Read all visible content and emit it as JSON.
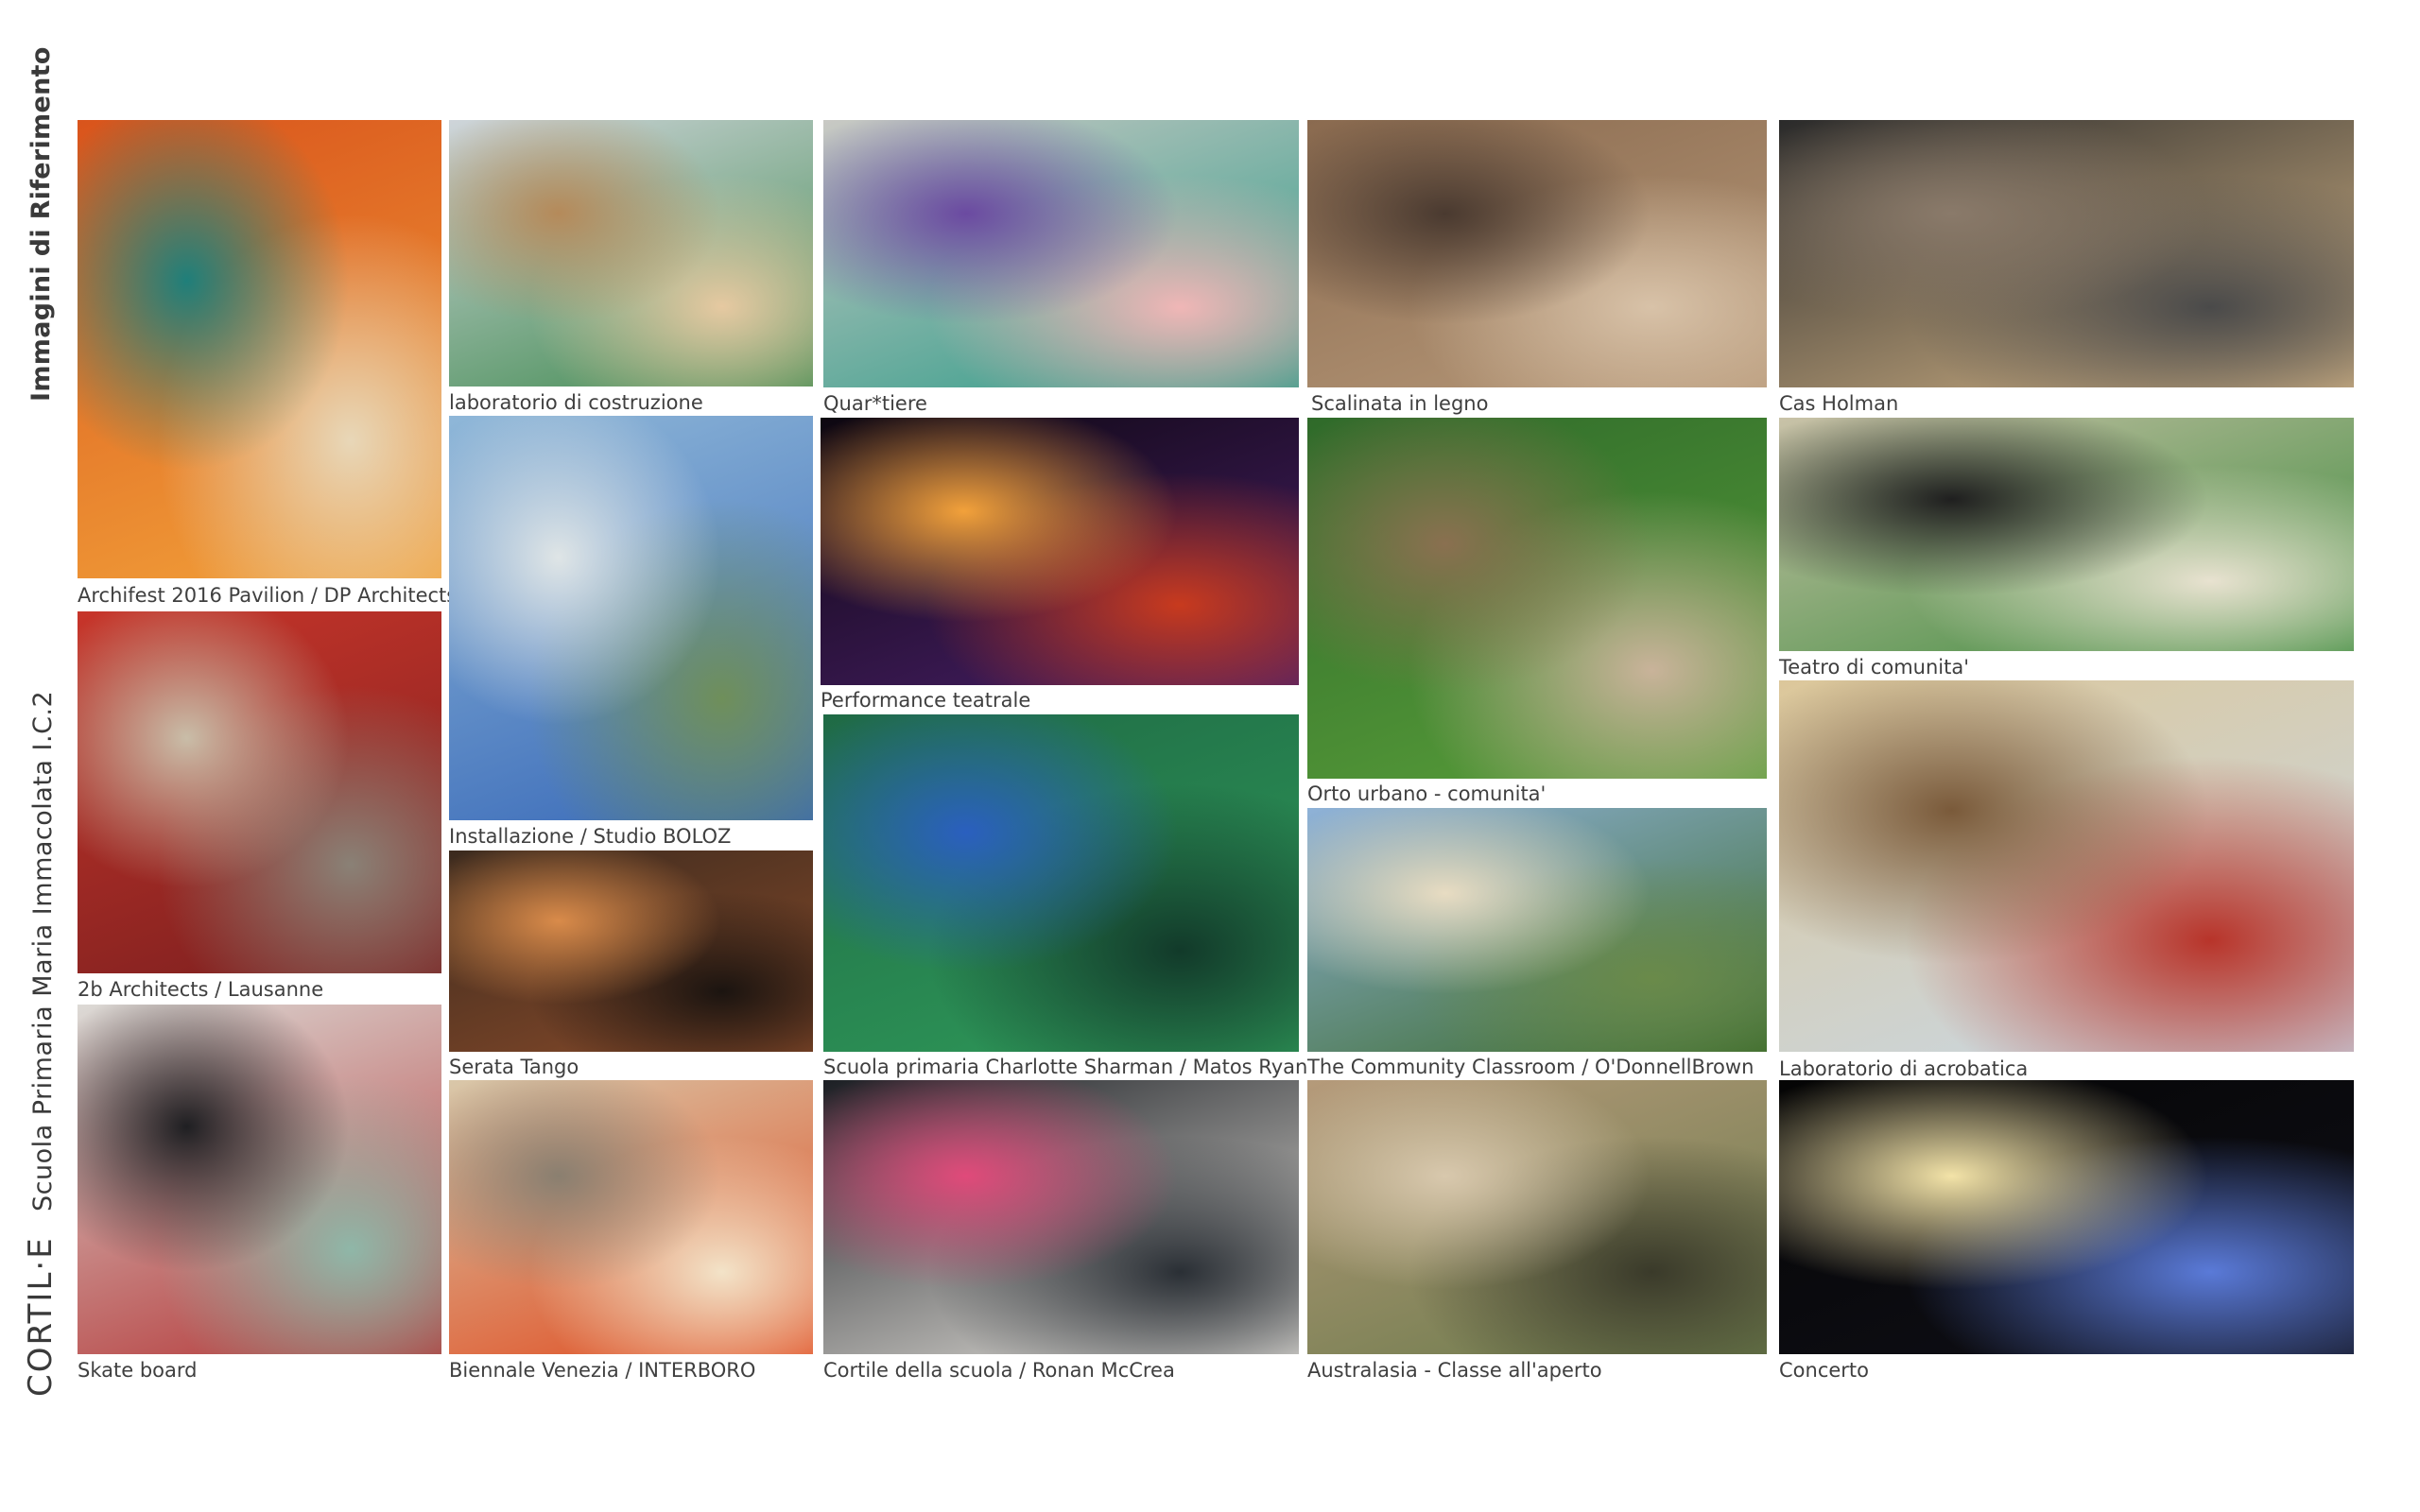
{
  "sidebar": {
    "section_title": "Immagini di Riferimento",
    "school_name": "Scuola Primaria Maria Immacolata I.C.2",
    "brand": "CORTIL·E"
  },
  "tiles": [
    {
      "caption": "Archifest 2016 Pavilion / DP Architects",
      "colors": [
        "#d9541c",
        "#f2a23a",
        "#1f7f7a",
        "#e8d7b8"
      ]
    },
    {
      "caption": "2b Architects / Lausanne",
      "colors": [
        "#c7352a",
        "#7a1f1f",
        "#c9bda8",
        "#8a8176"
      ]
    },
    {
      "caption": "Skate board",
      "colors": [
        "#dcdad6",
        "#b33434",
        "#1f1f22",
        "#8fb7a8"
      ]
    },
    {
      "caption": "laboratorio di costruzione",
      "colors": [
        "#cfd5da",
        "#3f8a4f",
        "#b58a5a",
        "#e6c9a1"
      ]
    },
    {
      "caption": "Installazione / Studio BOLOZ",
      "colors": [
        "#8fb7d8",
        "#3768b8",
        "#dfe5e6",
        "#6f8f5a"
      ]
    },
    {
      "caption": "Serata Tango",
      "colors": [
        "#3b2a1e",
        "#8a4b2a",
        "#d98b4a",
        "#1b1410"
      ]
    },
    {
      "caption": "Biennale Venezia / INTERBORO",
      "colors": [
        "#d9c8aa",
        "#e04a1e",
        "#8a7f70",
        "#f3e3c8"
      ]
    },
    {
      "caption": "Quar*tiere",
      "colors": [
        "#c9c9c4",
        "#2a9a86",
        "#6b4aa1",
        "#f0b6b6"
      ]
    },
    {
      "caption": "Performance teatrale",
      "colors": [
        "#0d0710",
        "#4a1f6a",
        "#f2a13a",
        "#c83a1e"
      ]
    },
    {
      "caption": "Scuola primaria Charlotte Sharman / Matos Ryan",
      "colors": [
        "#1f6a45",
        "#2f9b5a",
        "#2a5fbf",
        "#123a2a"
      ]
    },
    {
      "caption": "Cortile della scuola / Ronan McCrea",
      "colors": [
        "#1c1f24",
        "#e9e6e0",
        "#e04a7a",
        "#2a2f35"
      ]
    },
    {
      "caption": "Scalinata in legno",
      "colors": [
        "#8a6a4f",
        "#b89a7a",
        "#4a3a30",
        "#d8c2a8"
      ]
    },
    {
      "caption": "Orto urbano - comunita'",
      "colors": [
        "#2f6a2a",
        "#5aa03a",
        "#8a7050",
        "#c9b39a"
      ]
    },
    {
      "caption": "The Community Classroom / O'DonnellBrown",
      "colors": [
        "#8fb2d8",
        "#3a6a2a",
        "#e8dcc2",
        "#6a8a4a"
      ]
    },
    {
      "caption": "Australasia - Classe all'aperto",
      "colors": [
        "#b59a7a",
        "#6a7a4a",
        "#d8c8ad",
        "#3a3a2a"
      ]
    },
    {
      "caption": "Cas Holman",
      "colors": [
        "#2a2a2a",
        "#d9b98a",
        "#8a7a6a",
        "#4a4a4a"
      ]
    },
    {
      "caption": "Teatro di comunita'",
      "colors": [
        "#c9c2a8",
        "#3a8a3a",
        "#1f1f1f",
        "#e8e2d0"
      ]
    },
    {
      "caption": "Laboratorio di acrobatica",
      "colors": [
        "#dcc79a",
        "#c8d8e8",
        "#7a5a3a",
        "#b8342a"
      ]
    },
    {
      "caption": "Concerto",
      "colors": [
        "#050505",
        "#101018",
        "#f3e3a8",
        "#5a7ad8"
      ]
    }
  ]
}
